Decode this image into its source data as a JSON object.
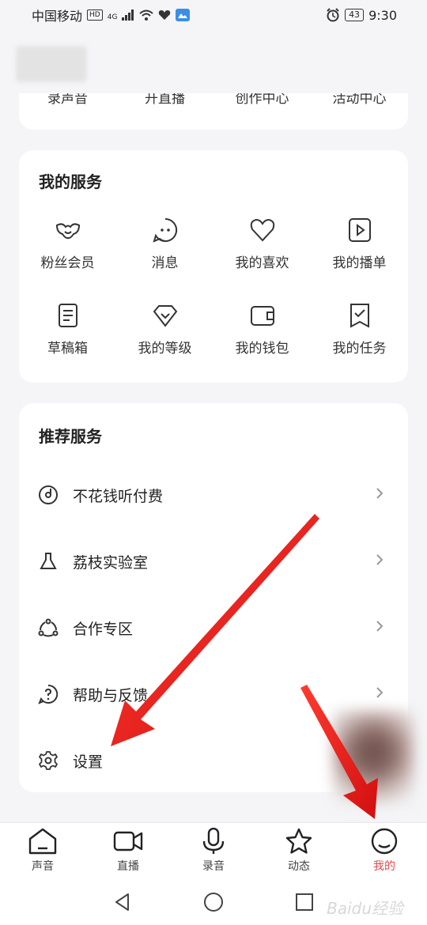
{
  "status_bar": {
    "carrier": "中国移动",
    "hd": "HD",
    "signal_type": "4G",
    "battery": "43",
    "time": "9:30"
  },
  "top_shortcuts": [
    "录声音",
    "开直播",
    "创作中心",
    "活动中心"
  ],
  "my_services": {
    "title": "我的服务",
    "items": [
      {
        "label": "粉丝会员",
        "icon": "fan-member-icon"
      },
      {
        "label": "消息",
        "icon": "message-icon"
      },
      {
        "label": "我的喜欢",
        "icon": "heart-icon"
      },
      {
        "label": "我的播单",
        "icon": "playlist-icon"
      },
      {
        "label": "草稿箱",
        "icon": "draft-icon"
      },
      {
        "label": "我的等级",
        "icon": "level-icon"
      },
      {
        "label": "我的钱包",
        "icon": "wallet-icon"
      },
      {
        "label": "我的任务",
        "icon": "task-icon"
      }
    ]
  },
  "recommended": {
    "title": "推荐服务",
    "items": [
      {
        "label": "不花钱听付费",
        "icon": "disc-icon"
      },
      {
        "label": "荔枝实验室",
        "icon": "flask-icon"
      },
      {
        "label": "合作专区",
        "icon": "cooperation-icon"
      },
      {
        "label": "帮助与反馈",
        "icon": "help-icon"
      },
      {
        "label": "设置",
        "icon": "gear-icon"
      }
    ]
  },
  "tabbar": {
    "items": [
      {
        "label": "声音",
        "icon": "home-icon"
      },
      {
        "label": "直播",
        "icon": "live-camera-icon"
      },
      {
        "label": "录音",
        "icon": "microphone-icon"
      },
      {
        "label": "动态",
        "icon": "star-icon"
      },
      {
        "label": "我的",
        "icon": "profile-icon"
      }
    ],
    "active_color": "#e5484d"
  },
  "watermark": "Baidu经验"
}
